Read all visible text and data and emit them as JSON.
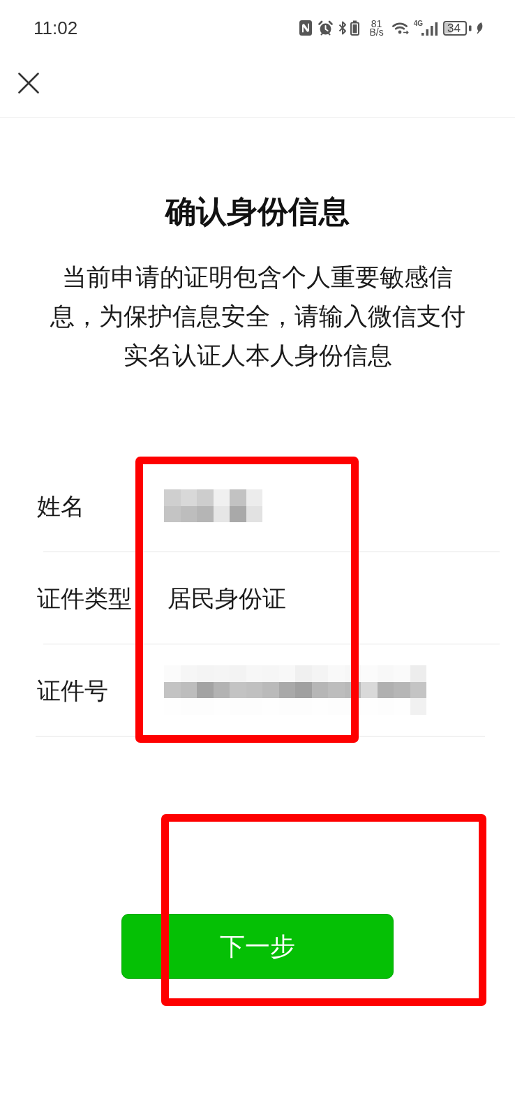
{
  "status_bar": {
    "time": "11:02",
    "net_speed_value": "81",
    "net_speed_unit": "B/s",
    "network_type": "4G",
    "battery": "34"
  },
  "title": "确认身份信息",
  "description": "当前申请的证明包含个人重要敏感信息，为保护信息安全，请输入微信支付实名认证人本人身份信息",
  "form": {
    "highlighted": true,
    "fields": [
      {
        "label": "姓名",
        "kind": "mosaic"
      },
      {
        "label": "证件类型",
        "kind": "text",
        "value": "居民身份证"
      },
      {
        "label": "证件号",
        "kind": "mosaic"
      }
    ]
  },
  "next_button": {
    "label": "下一步",
    "highlighted": true
  }
}
